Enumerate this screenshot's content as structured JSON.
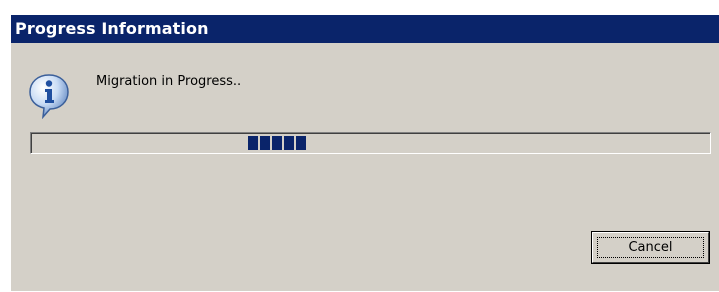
{
  "dialog": {
    "title": "Progress Information",
    "message": "Migration in Progress..",
    "icon": "information-icon",
    "progress": {
      "indeterminate": true,
      "visible_blocks": 5,
      "color": "#0a246a"
    },
    "cancel_label": "Cancel"
  },
  "colors": {
    "titlebar": "#0a246a",
    "face": "#d4d0c8",
    "title_text": "#ffffff"
  }
}
